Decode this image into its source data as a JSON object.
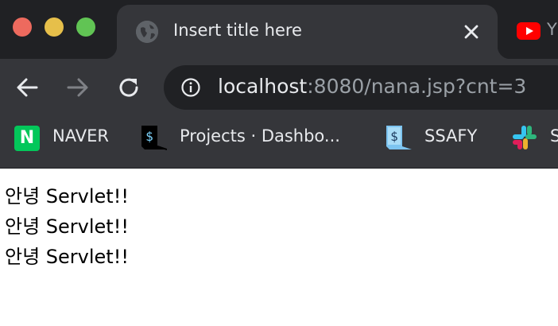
{
  "window": {
    "controls": [
      "close",
      "minimize",
      "zoom"
    ]
  },
  "tabs": [
    {
      "title": "Insert title here",
      "icon": "globe-icon",
      "active": true
    },
    {
      "title": "Y",
      "icon": "youtube-icon",
      "active": false
    }
  ],
  "toolbar": {
    "url_host": "localhost",
    "url_rest": ":8080/nana.jsp?cnt=3"
  },
  "bookmarks": [
    {
      "label": "NAVER",
      "icon": "naver-icon",
      "icon_text": "N"
    },
    {
      "label": "Projects · Dashbo...",
      "icon": "project-icon",
      "icon_text": "$"
    },
    {
      "label": "SSAFY",
      "icon": "ssafy-icon",
      "icon_text": "$"
    },
    {
      "label": "S",
      "icon": "slack-icon"
    }
  ],
  "page": {
    "lines": [
      "안녕 Servlet!!",
      "안녕 Servlet!!",
      "안녕 Servlet!!"
    ]
  },
  "colors": {
    "tabstrip": "#202124",
    "toolbar": "#35363a",
    "naver": "#03c75a",
    "youtube": "#ff0000"
  }
}
